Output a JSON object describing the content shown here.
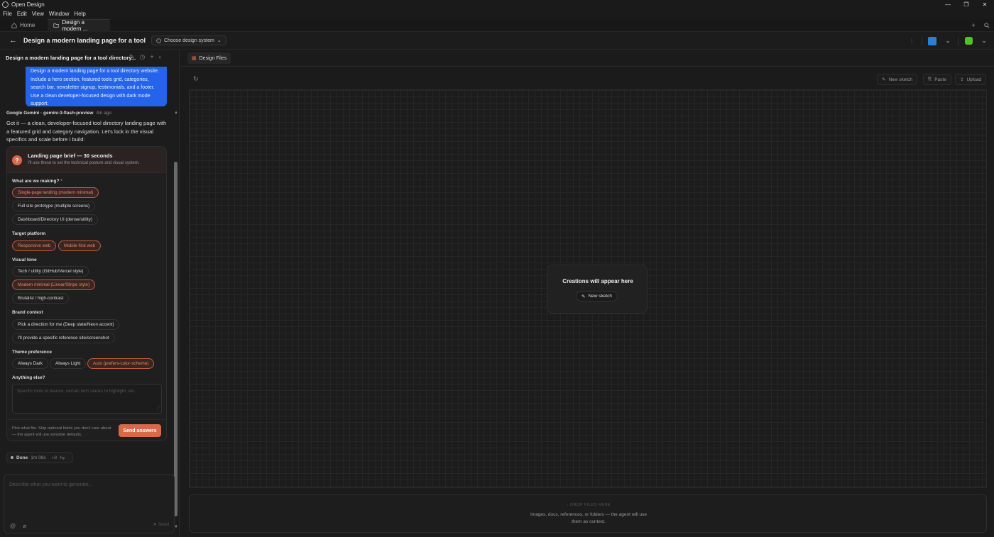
{
  "window": {
    "title": "Open Design"
  },
  "menu": [
    "File",
    "Edit",
    "View",
    "Window",
    "Help"
  ],
  "tabs": [
    {
      "label": "Home"
    },
    {
      "label": "Design a modern ..."
    }
  ],
  "header": {
    "title": "Design a modern landing page for a tool",
    "design_system": "Choose design system"
  },
  "chat": {
    "title": "Design a modern landing page for a tool directory...",
    "user_message": "Design a modern landing page for a  tool directory website. Include a hero section, featured tools grid, categories, search bar, newsletter signup, testimonials, and a footer. Use a clean developer-focused design with dark mode support.",
    "agent_name": "Google Gemini · gemini-3-flash-preview",
    "agent_time": "4m ago",
    "agent_text": "Got it — a clean, developer-focused tool directory landing page with a featured grid and category navigation. Let's lock in the visual specifics and scale before I build:",
    "done_label": "Done",
    "done_time": "1m 08s",
    "composer_placeholder": "Describe what you want to generate...",
    "send_label": "Send"
  },
  "form": {
    "title": "Landing page brief — 30 seconds",
    "subtitle": "I'll use these to set the technical posture and visual system.",
    "sections": [
      {
        "label": "What are we making?",
        "required": "*",
        "options": [
          "Single-page landing (modern minimal)",
          "Full site prototype (multiple screens)",
          "Dashboard/Directory UI (dense/utility)"
        ],
        "selected": [
          0
        ]
      },
      {
        "label": "Target platform",
        "options": [
          "Responsive web",
          "Mobile-first web"
        ],
        "selected": [
          0,
          1
        ]
      },
      {
        "label": "Visual tone",
        "options": [
          "Tech / utility (GitHub/Vercel style)",
          "Modern minimal (Linear/Stripe style)",
          "Brutalist / high-contrast"
        ],
        "selected": [
          1
        ]
      },
      {
        "label": "Brand context",
        "options": [
          "Pick a direction for me (Deep slate/Neon accent)",
          "I'll provide a specific reference site/screenshot"
        ],
        "selected": []
      },
      {
        "label": "Theme preference",
        "options": [
          "Always Dark",
          "Always Light",
          "Auto (prefers-color-scheme)"
        ],
        "selected": [
          2
        ]
      },
      {
        "label": "Anything else?"
      }
    ],
    "textarea_placeholder": "Specific tools to feature, certain tech stacks to highlight, etc.",
    "footer_hint": "Pick what fits. Skip optional fields you don't care about — the agent will use sensible defaults.",
    "submit_label": "Send answers"
  },
  "design_panel": {
    "tab_label": "Design Files",
    "actions": [
      "New sketch",
      "Paste",
      "Upload"
    ],
    "empty_title": "Creations will appear here",
    "empty_button": "New sketch",
    "drop_title": "↓ DROP FILES HERE",
    "drop_text": "Images, docs, references, or folders — the agent will use them as context."
  },
  "colors": {
    "accent": "#d9694a",
    "user_bubble": "#2563eb",
    "background": "#1b1b1b"
  }
}
